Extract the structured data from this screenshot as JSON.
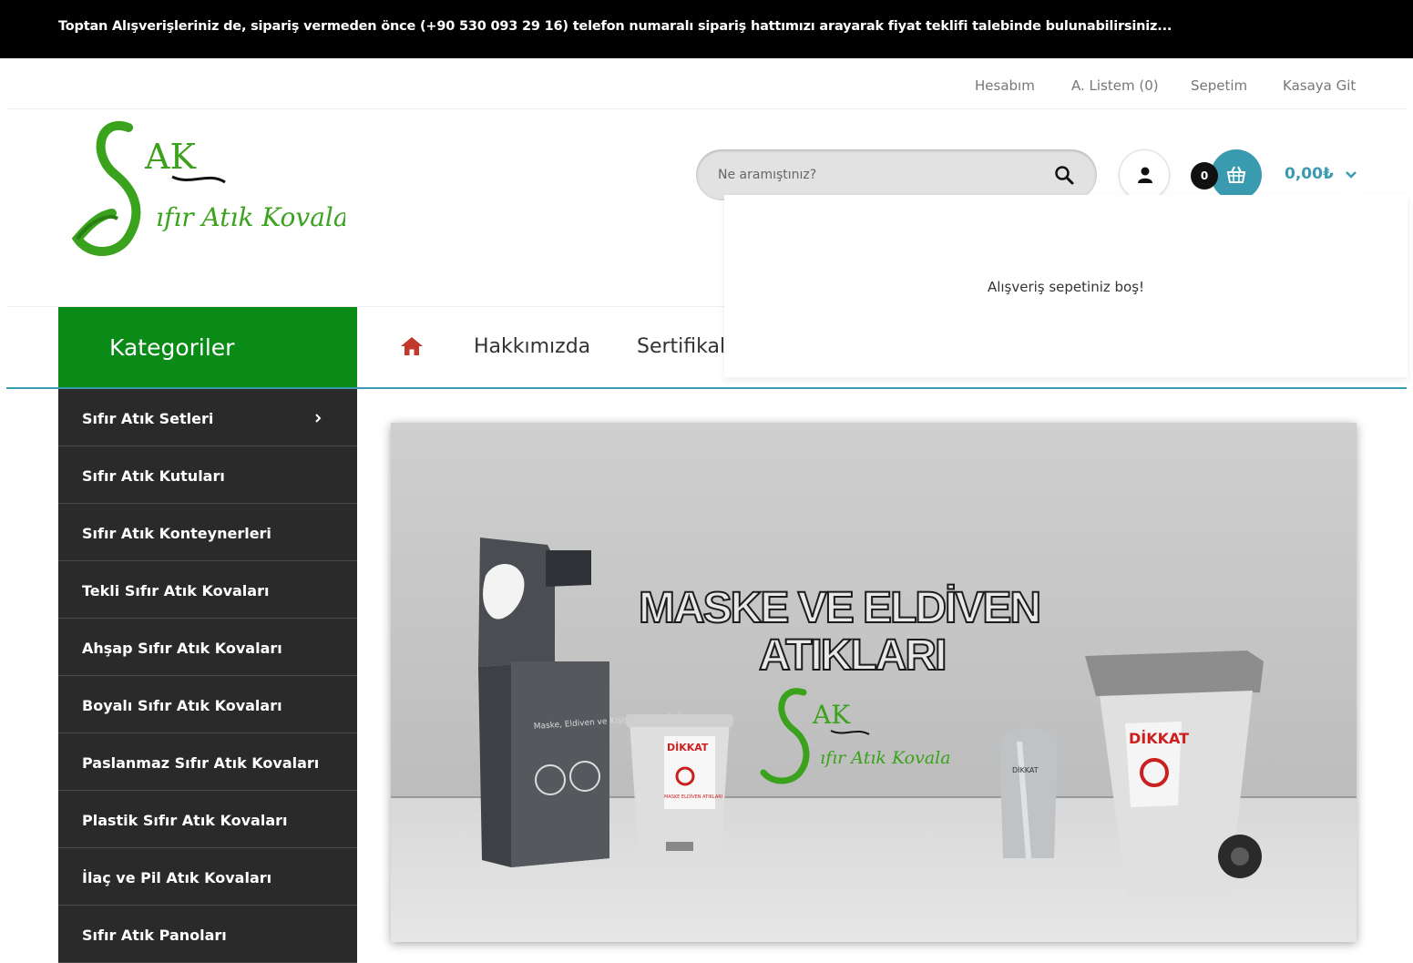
{
  "topbar": {
    "notice": "Toptan Alışverişleriniz de, sipariş vermeden önce (+90 530 093 29 16) telefon numaralı sipariş hattımızı arayarak fiyat teklifi talebinde bulunabilirsiniz..."
  },
  "utility": {
    "account": "Hesabım",
    "wishlist": "A. Listem (0)",
    "cart": "Sepetim",
    "checkout": "Kasaya Git"
  },
  "logo": {
    "initial": "S",
    "ak": "AK",
    "tagline": "ıfır Atık Kovaları"
  },
  "search": {
    "placeholder": "Ne aramıştınız?",
    "icon": "search-icon"
  },
  "account_icon": "user-icon",
  "cart": {
    "count": "0",
    "total": "0,00₺",
    "icon": "basket-icon",
    "empty_message": "Alışveriş sepetiniz boş!"
  },
  "categories": {
    "title": "Kategoriler",
    "items": [
      {
        "label": "Sıfır Atık Setleri",
        "has_children": true
      },
      {
        "label": "Sıfır Atık Kutuları",
        "has_children": false
      },
      {
        "label": "Sıfır Atık Konteynerleri",
        "has_children": false
      },
      {
        "label": "Tekli Sıfır Atık Kovaları",
        "has_children": false
      },
      {
        "label": "Ahşap Sıfır Atık Kovaları",
        "has_children": false
      },
      {
        "label": "Boyalı Sıfır Atık Kovaları",
        "has_children": false
      },
      {
        "label": "Paslanmaz Sıfır Atık Kovaları",
        "has_children": false
      },
      {
        "label": "Plastik Sıfır Atık Kovaları",
        "has_children": false
      },
      {
        "label": "İlaç ve Pil Atık Kovaları",
        "has_children": false
      },
      {
        "label": "Sıfır Atık Panoları",
        "has_children": false
      }
    ]
  },
  "nav": {
    "home_icon": "home-icon",
    "links": [
      "Hakkımızda",
      "Sertifikalar"
    ]
  },
  "banner": {
    "title_line1": "MASKE VE ELDİVEN",
    "title_line2": "ATIKLARI",
    "logo_ak": "AK",
    "logo_tagline": "ıfır Atık Kovaları",
    "stand_label": "Maske, Eldiven ve Kişisel Hijyen Atığı",
    "warning": "DİKKAT",
    "bin_label": "MASKE ELDİVEN ATIKLARI"
  },
  "colors": {
    "topbar": "#000000",
    "category_header": "#0a8a16",
    "menu_bg": "#2a2a2a",
    "accent": "#3a9bb0",
    "logo_green": "#3aa21c"
  }
}
